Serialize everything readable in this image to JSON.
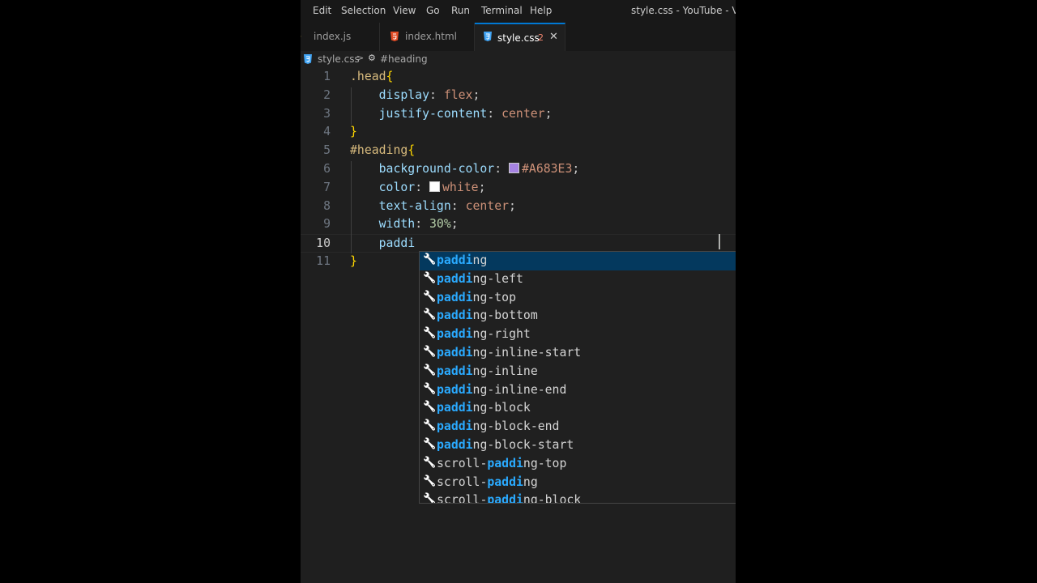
{
  "menubar": {
    "items": [
      "Edit",
      "Selection",
      "View",
      "Go",
      "Run",
      "Terminal",
      "Help"
    ],
    "window_title": "style.css - YouTube - Visua"
  },
  "tabs": [
    {
      "label": "index.js",
      "icon": "js-file-icon",
      "active": false
    },
    {
      "label": "index.html",
      "icon": "html-file-icon",
      "active": false
    },
    {
      "label": "style.css",
      "icon": "css-file-icon",
      "active": true,
      "badge": "2",
      "close": "✕"
    }
  ],
  "breadcrumb": {
    "file": "style.css",
    "separator": ">",
    "symbol": "#heading"
  },
  "editor": {
    "current_line": 10,
    "swatch_colors": {
      "purple": "#A683E3",
      "white": "#ffffff"
    },
    "lines": [
      {
        "num": "1",
        "tokens": [
          {
            "t": ".head",
            "c": "selector"
          },
          {
            "t": "{",
            "c": "brace"
          }
        ]
      },
      {
        "num": "2",
        "tokens": [
          {
            "t": "    ",
            "c": "punct"
          },
          {
            "t": "display",
            "c": "prop"
          },
          {
            "t": ": ",
            "c": "punct"
          },
          {
            "t": "flex",
            "c": "value"
          },
          {
            "t": ";",
            "c": "punct"
          }
        ]
      },
      {
        "num": "3",
        "tokens": [
          {
            "t": "    ",
            "c": "punct"
          },
          {
            "t": "justify-content",
            "c": "prop"
          },
          {
            "t": ": ",
            "c": "punct"
          },
          {
            "t": "center",
            "c": "value"
          },
          {
            "t": ";",
            "c": "punct"
          }
        ]
      },
      {
        "num": "4",
        "tokens": [
          {
            "t": "}",
            "c": "brace"
          }
        ]
      },
      {
        "num": "5",
        "tokens": [
          {
            "t": "#heading",
            "c": "selector"
          },
          {
            "t": "{",
            "c": "brace"
          }
        ]
      },
      {
        "num": "6",
        "tokens": [
          {
            "t": "    ",
            "c": "punct"
          },
          {
            "t": "background-color",
            "c": "prop"
          },
          {
            "t": ": ",
            "c": "punct"
          },
          {
            "t": "",
            "c": "swatch",
            "color": "#A683E3"
          },
          {
            "t": "#A683E3",
            "c": "value"
          },
          {
            "t": ";",
            "c": "punct"
          }
        ]
      },
      {
        "num": "7",
        "tokens": [
          {
            "t": "    ",
            "c": "punct"
          },
          {
            "t": "color",
            "c": "prop"
          },
          {
            "t": ": ",
            "c": "punct"
          },
          {
            "t": "",
            "c": "swatch",
            "color": "#ffffff"
          },
          {
            "t": "white",
            "c": "value"
          },
          {
            "t": ";",
            "c": "punct"
          }
        ]
      },
      {
        "num": "8",
        "tokens": [
          {
            "t": "    ",
            "c": "punct"
          },
          {
            "t": "text-align",
            "c": "prop"
          },
          {
            "t": ": ",
            "c": "punct"
          },
          {
            "t": "center",
            "c": "value"
          },
          {
            "t": ";",
            "c": "punct"
          }
        ]
      },
      {
        "num": "9",
        "tokens": [
          {
            "t": "    ",
            "c": "punct"
          },
          {
            "t": "width",
            "c": "prop"
          },
          {
            "t": ": ",
            "c": "punct"
          },
          {
            "t": "30%",
            "c": "number"
          },
          {
            "t": ";",
            "c": "punct"
          }
        ]
      },
      {
        "num": "10",
        "tokens": [
          {
            "t": "    ",
            "c": "punct"
          },
          {
            "t": "paddi",
            "c": "prop"
          }
        ]
      },
      {
        "num": "11",
        "tokens": [
          {
            "t": "}",
            "c": "brace"
          }
        ]
      }
    ]
  },
  "suggestions": {
    "query": "paddi",
    "items": [
      {
        "label": "padding",
        "selected": true
      },
      {
        "label": "padding-left"
      },
      {
        "label": "padding-top"
      },
      {
        "label": "padding-bottom"
      },
      {
        "label": "padding-right"
      },
      {
        "label": "padding-inline-start"
      },
      {
        "label": "padding-inline"
      },
      {
        "label": "padding-inline-end"
      },
      {
        "label": "padding-block"
      },
      {
        "label": "padding-block-end"
      },
      {
        "label": "padding-block-start"
      },
      {
        "label": "scroll-padding-top"
      },
      {
        "label": "scroll-padding"
      },
      {
        "label": "scroll-padding-block"
      }
    ]
  }
}
